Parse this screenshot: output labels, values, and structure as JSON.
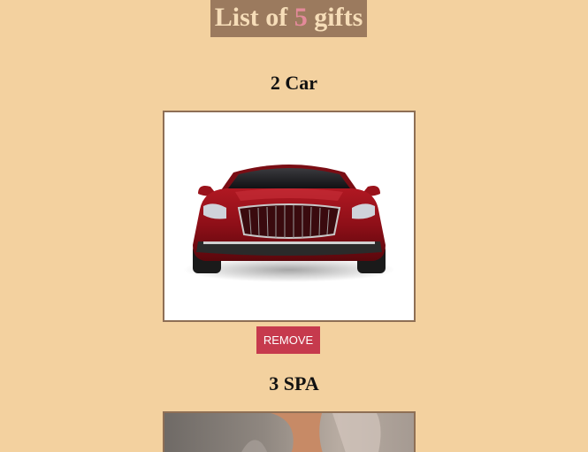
{
  "header": {
    "prefix": "List of ",
    "count": "5",
    "suffix": " gifts"
  },
  "gifts": [
    {
      "number": "2",
      "name": "Car",
      "remove_label": "REMOVE",
      "image": "red-car-photo"
    },
    {
      "number": "3",
      "name": "SPA",
      "image": "spa-photo"
    }
  ],
  "colors": {
    "page_bg": "#f3d19f",
    "title_bg": "#9b7a5e",
    "title_text": "#f6ddb8",
    "count_text": "#e48a9a",
    "remove_button": "#c63a4d",
    "frame_border": "#8e6f55"
  }
}
